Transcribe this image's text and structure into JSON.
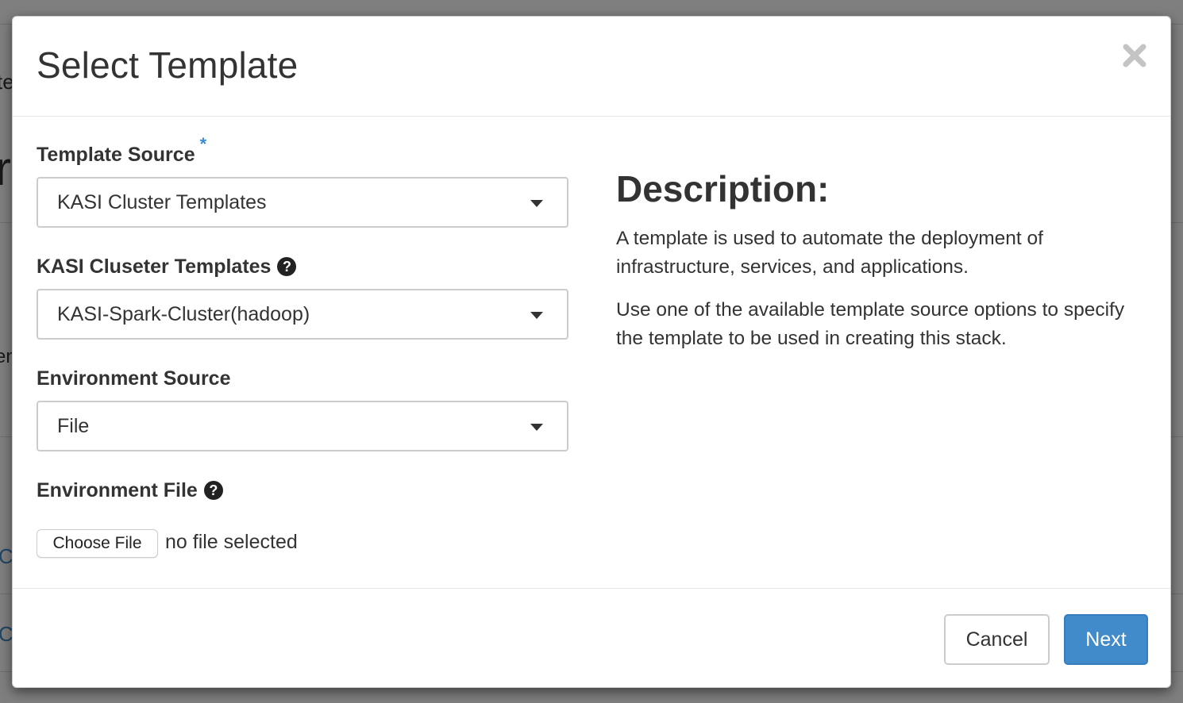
{
  "background": {
    "fragments": [
      "te",
      "r",
      "en",
      "C",
      "C"
    ]
  },
  "modal": {
    "title": "Select Template",
    "close_glyph": "×"
  },
  "form": {
    "template_source": {
      "label": "Template Source",
      "required_marker": "*",
      "selected": "KASI Cluster Templates"
    },
    "cluster_templates": {
      "label": "KASI Cluseter Templates",
      "help_glyph": "?",
      "selected": "KASI-Spark-Cluster(hadoop)"
    },
    "environment_source": {
      "label": "Environment Source",
      "selected": "File"
    },
    "environment_file": {
      "label": "Environment File",
      "help_glyph": "?",
      "button_label": "Choose File",
      "status": "no file selected"
    }
  },
  "description": {
    "title": "Description:",
    "paragraphs": [
      "A template is used to automate the deployment of infrastructure, services, and applications.",
      "Use one of the available template source options to specify the template to be used in creating this stack."
    ]
  },
  "footer": {
    "cancel_label": "Cancel",
    "next_label": "Next"
  },
  "colors": {
    "primary": "#428bca",
    "required_star": "#3c8dd0",
    "backdrop": "#7a7a7a"
  },
  "icons": [
    "close-icon",
    "help-icon",
    "caret-down-icon"
  ]
}
